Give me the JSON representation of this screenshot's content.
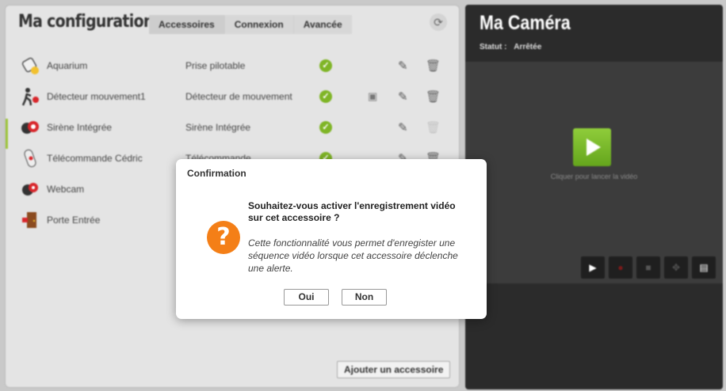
{
  "config": {
    "title": "Ma configuration:",
    "tabs": [
      {
        "label": "Accessoires",
        "active": true
      },
      {
        "label": "Connexion",
        "active": false
      },
      {
        "label": "Avancée",
        "active": false
      }
    ],
    "refresh_icon": "⟳",
    "accessories": [
      {
        "name": "Aquarium",
        "type": "Prise pilotable",
        "icon": "plug-icon",
        "video": false,
        "delete_enabled": true
      },
      {
        "name": "Détecteur mouvement1",
        "type": "Détecteur de mouvement",
        "icon": "motion-detector-icon",
        "video": true,
        "delete_enabled": true
      },
      {
        "name": "Sirène Intégrée",
        "type": "Sirène Intégrée",
        "icon": "siren-icon",
        "video": false,
        "delete_enabled": false
      },
      {
        "name": "Télécommande Cédric",
        "type": "Télécommande",
        "icon": "remote-icon",
        "video": false,
        "delete_enabled": true
      },
      {
        "name": "Webcam",
        "type": "",
        "icon": "webcam-icon",
        "video": false,
        "delete_enabled": true
      },
      {
        "name": "Porte Entrée",
        "type": "",
        "icon": "door-icon",
        "video": false,
        "delete_enabled": true
      }
    ],
    "add_button": "Ajouter un accessoire"
  },
  "camera": {
    "title": "Ma Caméra",
    "status_label": "Statut :",
    "status_value": "Arrêtée",
    "hint": "Cliquer pour lancer la vidéo"
  },
  "dialog": {
    "title": "Confirmation",
    "question": "Souhaitez-vous activer l'enregistrement vidéo sur cet accessoire ?",
    "description": "Cette fonctionnalité vous permet d'enregister une séquence vidéo lorsque cet accessoire déclenche une alerte.",
    "yes_label": "Oui",
    "no_label": "Non"
  },
  "colors": {
    "accent_green": "#7fb526",
    "warning_orange": "#f47f17",
    "camera_bg": "#2b2b2b"
  }
}
